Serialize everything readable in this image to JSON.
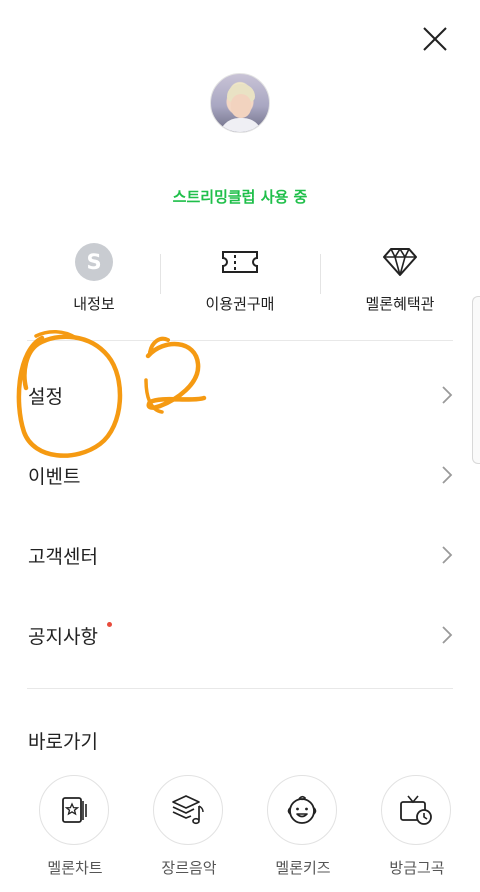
{
  "header": {
    "close_icon": "close-icon"
  },
  "profile": {
    "avatar": "avatar-photo",
    "status_text": "스트리밍클럽 사용 중",
    "status_color": "#1fbf4a"
  },
  "quick_menu": [
    {
      "label": "내정보",
      "icon": "user-initial-icon",
      "initial": "S"
    },
    {
      "label": "이용권구매",
      "icon": "ticket-icon"
    },
    {
      "label": "멜론혜택관",
      "icon": "diamond-icon"
    }
  ],
  "menu": [
    {
      "label": "설정",
      "icon": "chevron-right-icon"
    },
    {
      "label": "이벤트",
      "icon": "chevron-right-icon"
    },
    {
      "label": "고객센터",
      "icon": "chevron-right-icon"
    },
    {
      "label": "공지사항",
      "icon": "chevron-right-icon",
      "badge_color": "#e84b3c"
    }
  ],
  "shortcuts": {
    "title": "바로가기",
    "items": [
      {
        "label": "멜론차트",
        "icon": "chart-star-icon"
      },
      {
        "label": "장르음악",
        "icon": "genre-layers-icon"
      },
      {
        "label": "멜론키즈",
        "icon": "kids-face-icon"
      },
      {
        "label": "방금그곡",
        "icon": "tv-clock-icon"
      }
    ]
  },
  "annotation": {
    "color": "#f59a12",
    "number": "2"
  }
}
